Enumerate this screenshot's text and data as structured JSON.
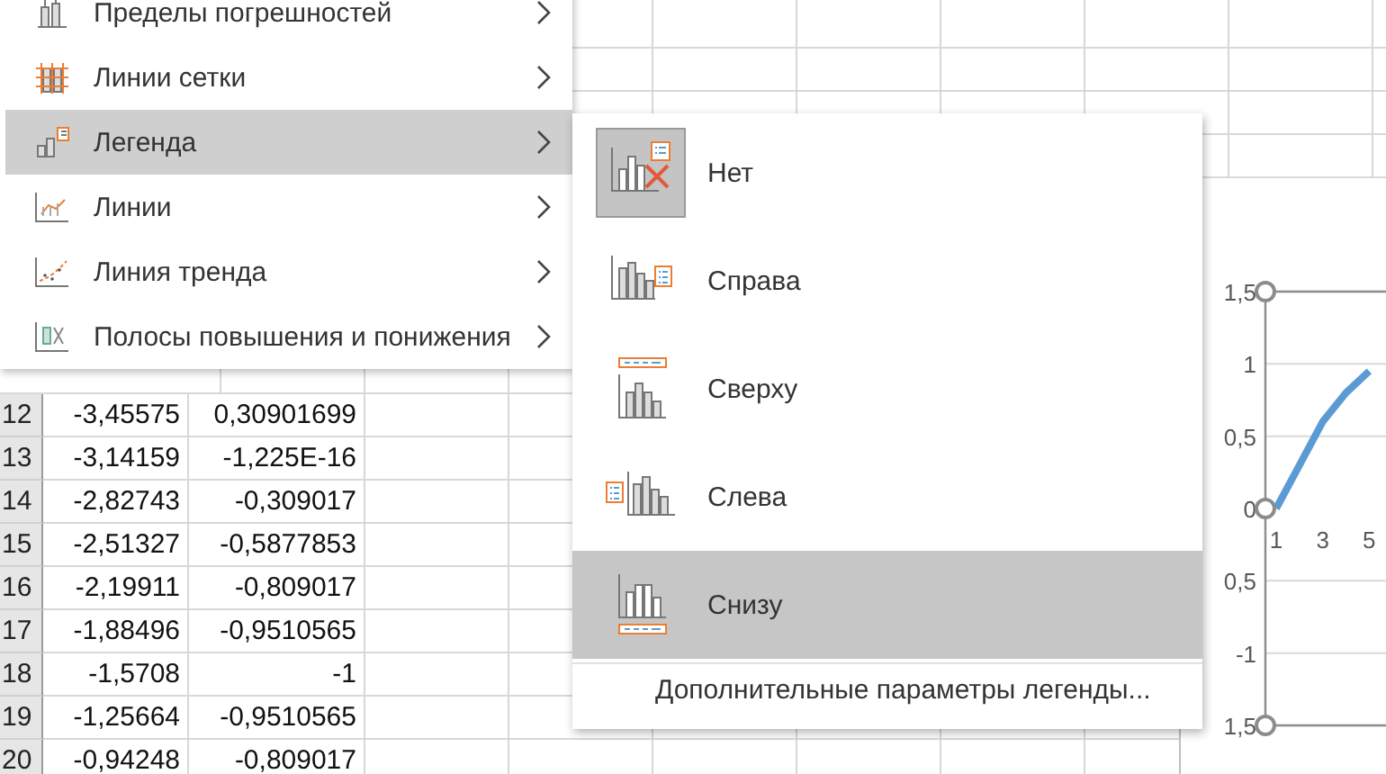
{
  "sheet": {
    "rows": [
      {
        "number": "12",
        "a": "-3,45575",
        "b": "0,30901699"
      },
      {
        "number": "13",
        "a": "-3,14159",
        "b": "-1,225E-16"
      },
      {
        "number": "14",
        "a": "-2,82743",
        "b": "-0,309017"
      },
      {
        "number": "15",
        "a": "-2,51327",
        "b": "-0,5877853"
      },
      {
        "number": "16",
        "a": "-2,19911",
        "b": "-0,809017"
      },
      {
        "number": "17",
        "a": "-1,88496",
        "b": "-0,9510565"
      },
      {
        "number": "18",
        "a": "-1,5708",
        "b": "-1"
      },
      {
        "number": "19",
        "a": "-1,25664",
        "b": "-0,9510565"
      },
      {
        "number": "20",
        "a": "-0,94248",
        "b": "-0,809017"
      }
    ]
  },
  "chart": {
    "chart_data": {
      "type": "line",
      "x": [
        1,
        2,
        3,
        4,
        5
      ],
      "grid": true,
      "series": [
        {
          "color": "#5b9bd5",
          "values": [
            0,
            0.3,
            0.6,
            0.8,
            0.95
          ]
        }
      ],
      "ylim": [
        -1.5,
        1.5
      ],
      "yticks": [
        {
          "value": 1.5,
          "label": "1,5"
        },
        {
          "value": 1,
          "label": "1"
        },
        {
          "value": 0.5,
          "label": "0,5"
        },
        {
          "value": 0,
          "label": "0"
        },
        {
          "value": -0.5,
          "label": "0,5"
        },
        {
          "value": -1,
          "label": "-1"
        },
        {
          "value": -1.5,
          "label": "1,5"
        }
      ],
      "xticks": [
        1,
        3,
        5
      ],
      "xlim": [
        1,
        5.8
      ]
    }
  },
  "menu": {
    "items": [
      {
        "kind": "error_bars",
        "label": "Пределы погрешностей",
        "selected": false
      },
      {
        "kind": "gridlines",
        "label": "Линии сетки",
        "selected": false
      },
      {
        "kind": "legend",
        "label": "Легенда",
        "selected": true
      },
      {
        "kind": "lines",
        "label": "Линии",
        "selected": false
      },
      {
        "kind": "trendline",
        "label": "Линия тренда",
        "selected": false
      },
      {
        "kind": "updown_bars",
        "label": "Полосы повышения и понижения",
        "selected": false
      }
    ]
  },
  "submenu": {
    "items": [
      {
        "kind": "none",
        "label": "Нет",
        "checked": true,
        "selected": false
      },
      {
        "kind": "right",
        "label": "Справа",
        "checked": false,
        "selected": false
      },
      {
        "kind": "top",
        "label": "Сверху",
        "checked": false,
        "selected": false
      },
      {
        "kind": "left",
        "label": "Слева",
        "checked": false,
        "selected": false
      },
      {
        "kind": "bottom",
        "label": "Снизу",
        "checked": false,
        "selected": true
      }
    ],
    "more_options": "Дополнительные параметры легенды..."
  }
}
